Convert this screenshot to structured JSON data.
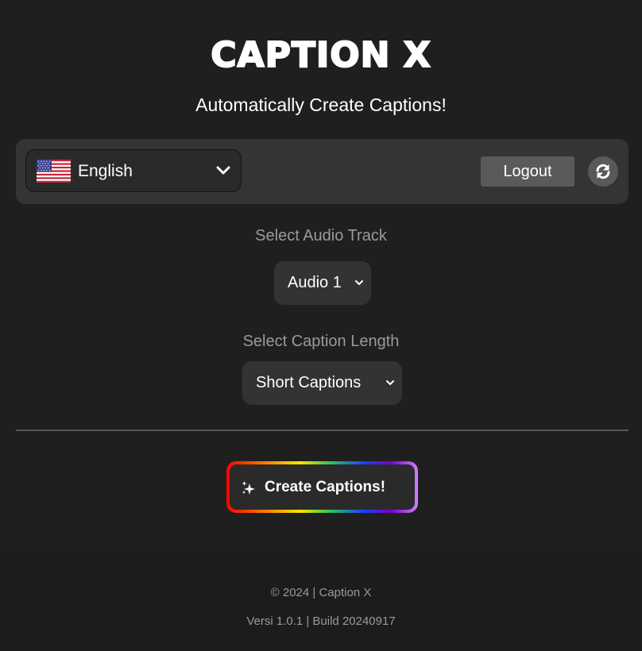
{
  "header": {
    "logo_text": "CAPTION X",
    "subtitle": "Automatically Create Captions!"
  },
  "toolbar": {
    "language": {
      "selected": "English",
      "flag_icon": "us-flag-icon",
      "chevron_icon": "chevron-down-icon"
    },
    "logout_label": "Logout",
    "refresh_icon": "refresh-icon"
  },
  "audio_track": {
    "label": "Select Audio Track",
    "selected": "Audio 1"
  },
  "caption_length": {
    "label": "Select Caption Length",
    "selected": "Short Captions"
  },
  "create_button": {
    "label": "Create Captions!",
    "icon": "sparkles-icon"
  },
  "footer": {
    "copyright": "© 2024 | Caption X",
    "version": "Versi 1.0.1 | Build 20240917"
  },
  "colors": {
    "background": "#1f1f1f",
    "panel": "#343434",
    "muted_text": "#9a9a9a",
    "logout_bg": "#5a5a5a"
  }
}
